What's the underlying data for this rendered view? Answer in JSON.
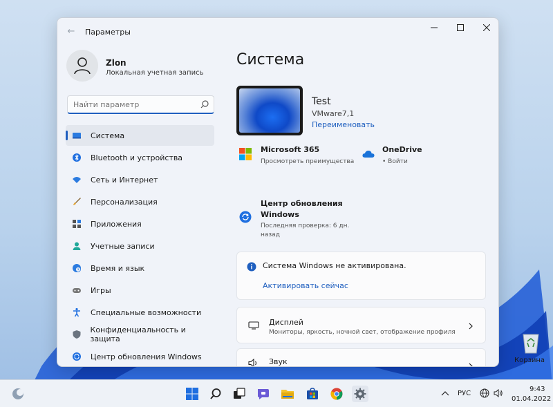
{
  "window": {
    "title": "Параметры"
  },
  "user": {
    "name": "Zlon",
    "account_type": "Локальная учетная запись"
  },
  "search": {
    "placeholder": "Найти параметр"
  },
  "sidebar": {
    "items": [
      {
        "label": "Система",
        "icon": "system-icon",
        "active": true
      },
      {
        "label": "Bluetooth и устройства",
        "icon": "bluetooth-icon"
      },
      {
        "label": "Сеть и Интернет",
        "icon": "wifi-icon"
      },
      {
        "label": "Персонализация",
        "icon": "brush-icon"
      },
      {
        "label": "Приложения",
        "icon": "apps-icon"
      },
      {
        "label": "Учетные записи",
        "icon": "person-icon"
      },
      {
        "label": "Время и язык",
        "icon": "globe-clock-icon"
      },
      {
        "label": "Игры",
        "icon": "gamepad-icon"
      },
      {
        "label": "Специальные возможности",
        "icon": "accessibility-icon"
      },
      {
        "label": "Конфиденциальность и защита",
        "icon": "shield-icon"
      },
      {
        "label": "Центр обновления Windows",
        "icon": "update-icon"
      }
    ]
  },
  "main": {
    "title": "Система",
    "device": {
      "name": "Test",
      "model": "VMware7,1",
      "rename_link": "Переименовать"
    },
    "tiles": {
      "ms365_title": "Microsoft 365",
      "ms365_sub": "Просмотреть преимущества",
      "onedrive_title": "OneDrive",
      "onedrive_sub": "• Войти",
      "update_title_line1": "Центр обновления",
      "update_title_line2": "Windows",
      "update_sub_line1": "Последняя проверка: 6 дн.",
      "update_sub_line2": "назад"
    },
    "activation": {
      "message": "Система Windows не активирована.",
      "link": "Активировать сейчас"
    },
    "display": {
      "title": "Дисплей",
      "subtitle": "Мониторы, яркость, ночной свет, отображение профиля"
    },
    "sound": {
      "title": "Звук"
    }
  },
  "desktop": {
    "recycle_bin_label": "Корзина"
  },
  "taskbar": {
    "language": "РУС",
    "time": "9:43",
    "date": "01.04.2022"
  },
  "colors": {
    "accent": "#1f5fbf",
    "window_bg": "#f0f3f9"
  }
}
